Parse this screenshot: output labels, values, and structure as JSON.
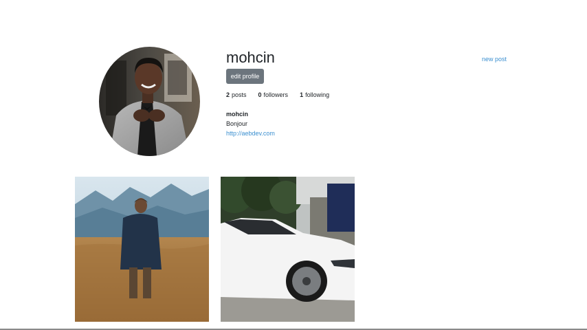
{
  "profile": {
    "username": "mohcin",
    "edit_button": "edit profile",
    "new_post_link": "new post",
    "stats": {
      "posts_count": "2",
      "posts_label": "posts",
      "followers_count": "0",
      "followers_label": "followers",
      "following_count": "1",
      "following_label": "following"
    },
    "bio": {
      "name": "mohcin",
      "text": "Bonjour",
      "link": "http://aebdev.com"
    }
  },
  "posts": [
    {
      "subject": "person-in-wheat-field-photo"
    },
    {
      "subject": "white-car-photo"
    }
  ],
  "colors": {
    "link": "#3b8fd0",
    "button_bg": "#6c757d",
    "text": "#212529"
  }
}
